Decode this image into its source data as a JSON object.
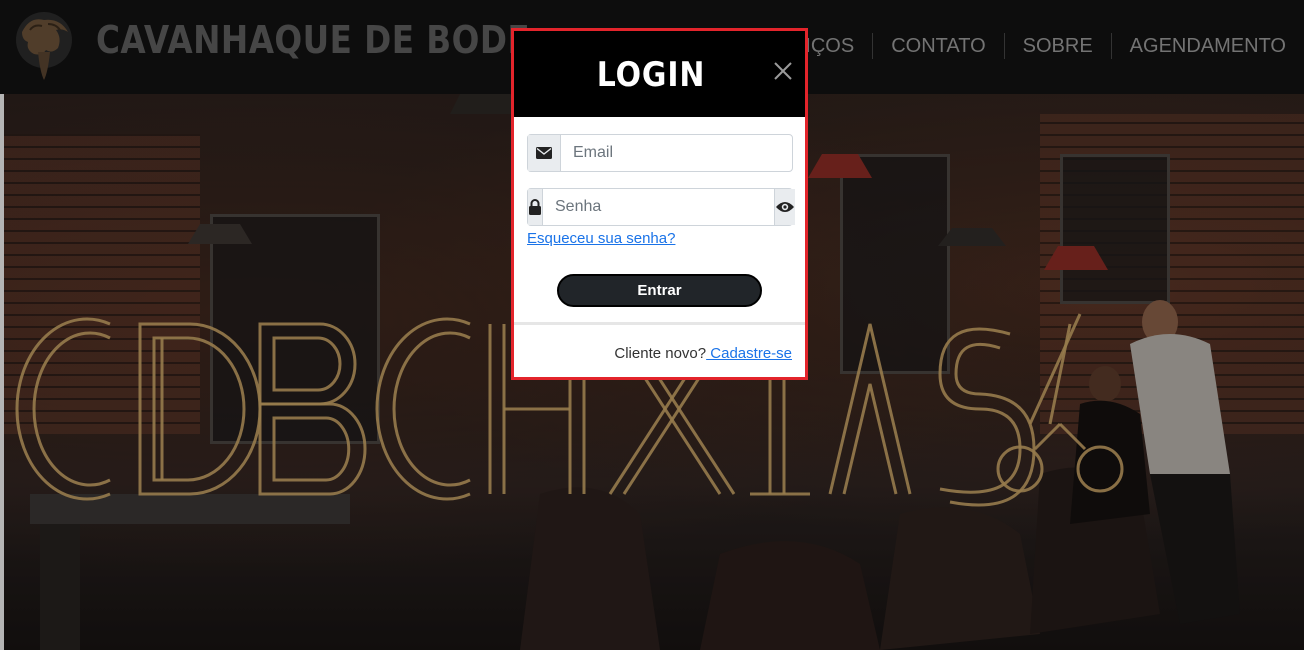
{
  "navbar": {
    "brand": "CAVANHAQUE DE BODE",
    "links": [
      {
        "label": "SERVIÇOS"
      },
      {
        "label": "CONTATO"
      },
      {
        "label": "SOBRE"
      },
      {
        "label": "AGENDAMENTO"
      }
    ]
  },
  "hero": {
    "neon_text": "CDB CAXIAS"
  },
  "modal": {
    "title": "LOGIN",
    "email": {
      "placeholder": "Email",
      "value": ""
    },
    "password": {
      "placeholder": "Senha",
      "value": ""
    },
    "forgot_link": "Esqueceu sua senha?",
    "submit_label": "Entrar",
    "footer_prefix": "Cliente novo?",
    "footer_link": " Cadastre-se"
  },
  "icons": {
    "email": "envelope-icon",
    "password": "lock-icon",
    "toggle": "eye-icon",
    "close": "close-icon"
  },
  "colors": {
    "modal_border": "#e3242b",
    "neon": "#c9a466",
    "link": "#1a73e8",
    "button": "#212529"
  }
}
